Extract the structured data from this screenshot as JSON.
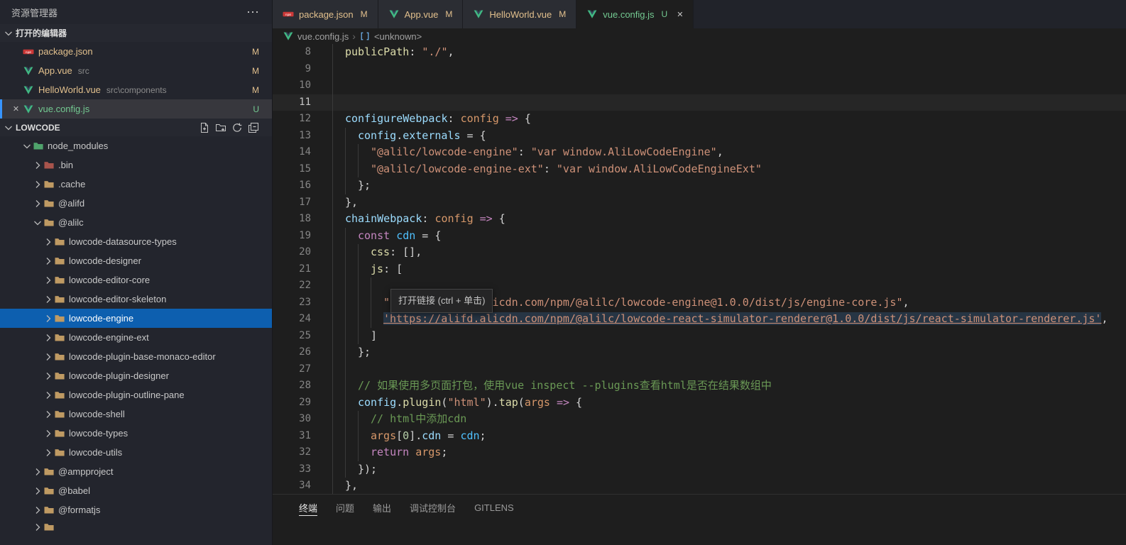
{
  "colors": {
    "accent_blue": "#0d5faf",
    "git_modified": "#e2c08d",
    "git_untracked": "#73c991",
    "folders": {
      "tan": "#bf9a63",
      "green": "#4fa36c",
      "red": "#a8544c"
    }
  },
  "explorer": {
    "title": "资源管理器",
    "open_editors": {
      "header": "打开的编辑器",
      "items": [
        {
          "icon": "npm-icon",
          "name": "package.json",
          "path": "",
          "badge": "M",
          "status": "modified",
          "active": false
        },
        {
          "icon": "vue-icon",
          "name": "App.vue",
          "path": "src",
          "badge": "M",
          "status": "modified",
          "active": false
        },
        {
          "icon": "vue-icon",
          "name": "HelloWorld.vue",
          "path": "src\\components",
          "badge": "M",
          "status": "modified",
          "active": false
        },
        {
          "icon": "vue-icon",
          "name": "vue.config.js",
          "path": "",
          "badge": "U",
          "status": "untracked",
          "active": true
        }
      ]
    },
    "project": {
      "header": "LOWCODE",
      "actions": [
        "new-file-icon",
        "new-folder-icon",
        "refresh-icon",
        "collapse-all-icon"
      ],
      "tree": [
        {
          "label": "node_modules",
          "depth": 0,
          "expanded": true,
          "folder": "green",
          "selected": false
        },
        {
          "label": ".bin",
          "depth": 1,
          "expanded": false,
          "folder": "red",
          "selected": false
        },
        {
          "label": ".cache",
          "depth": 1,
          "expanded": false,
          "folder": "tan",
          "selected": false
        },
        {
          "label": "@alifd",
          "depth": 1,
          "expanded": false,
          "folder": "tan",
          "selected": false
        },
        {
          "label": "@alilc",
          "depth": 1,
          "expanded": true,
          "folder": "tan",
          "selected": false
        },
        {
          "label": "lowcode-datasource-types",
          "depth": 2,
          "expanded": false,
          "folder": "tan",
          "selected": false
        },
        {
          "label": "lowcode-designer",
          "depth": 2,
          "expanded": false,
          "folder": "tan",
          "selected": false
        },
        {
          "label": "lowcode-editor-core",
          "depth": 2,
          "expanded": false,
          "folder": "tan",
          "selected": false
        },
        {
          "label": "lowcode-editor-skeleton",
          "depth": 2,
          "expanded": false,
          "folder": "tan",
          "selected": false
        },
        {
          "label": "lowcode-engine",
          "depth": 2,
          "expanded": false,
          "folder": "tan",
          "selected": true
        },
        {
          "label": "lowcode-engine-ext",
          "depth": 2,
          "expanded": false,
          "folder": "tan",
          "selected": false
        },
        {
          "label": "lowcode-plugin-base-monaco-editor",
          "depth": 2,
          "expanded": false,
          "folder": "tan",
          "selected": false
        },
        {
          "label": "lowcode-plugin-designer",
          "depth": 2,
          "expanded": false,
          "folder": "tan",
          "selected": false
        },
        {
          "label": "lowcode-plugin-outline-pane",
          "depth": 2,
          "expanded": false,
          "folder": "tan",
          "selected": false
        },
        {
          "label": "lowcode-shell",
          "depth": 2,
          "expanded": false,
          "folder": "tan",
          "selected": false
        },
        {
          "label": "lowcode-types",
          "depth": 2,
          "expanded": false,
          "folder": "tan",
          "selected": false
        },
        {
          "label": "lowcode-utils",
          "depth": 2,
          "expanded": false,
          "folder": "tan",
          "selected": false
        },
        {
          "label": "@ampproject",
          "depth": 1,
          "expanded": false,
          "folder": "tan",
          "selected": false
        },
        {
          "label": "@babel",
          "depth": 1,
          "expanded": false,
          "folder": "tan",
          "selected": false
        },
        {
          "label": "@formatjs",
          "depth": 1,
          "expanded": false,
          "folder": "tan",
          "selected": false
        },
        {
          "label": "",
          "depth": 1,
          "expanded": false,
          "folder": "tan",
          "selected": false,
          "partial": true
        }
      ]
    }
  },
  "tabs": [
    {
      "icon": "npm-icon",
      "label": "package.json",
      "badge": "M",
      "status": "modified",
      "active": false
    },
    {
      "icon": "vue-icon",
      "label": "App.vue",
      "badge": "M",
      "status": "modified",
      "active": false
    },
    {
      "icon": "vue-icon",
      "label": "HelloWorld.vue",
      "badge": "M",
      "status": "modified",
      "active": false
    },
    {
      "icon": "vue-icon",
      "label": "vue.config.js",
      "badge": "U",
      "status": "untracked",
      "active": true
    }
  ],
  "breadcrumb": {
    "items": [
      {
        "icon": "vue-icon",
        "label": "vue.config.js"
      },
      {
        "icon": "symbol-icon",
        "label": "<unknown>"
      }
    ]
  },
  "editor": {
    "lines": [
      {
        "n": 8,
        "ind": 2,
        "active": false,
        "tokens": [
          [
            "f",
            "publicPath"
          ],
          [
            "p",
            ": "
          ],
          [
            "s",
            "\"./\""
          ],
          [
            "p",
            ","
          ]
        ]
      },
      {
        "n": 9,
        "ind": 2,
        "active": false,
        "tokens": []
      },
      {
        "n": 10,
        "ind": 2,
        "active": false,
        "tokens": []
      },
      {
        "n": 11,
        "ind": 2,
        "active": true,
        "tokens": []
      },
      {
        "n": 12,
        "ind": 2,
        "active": false,
        "tokens": [
          [
            "v",
            "configureWebpack"
          ],
          [
            "p",
            ": "
          ],
          [
            "a",
            "config"
          ],
          [
            "p",
            " "
          ],
          [
            "k",
            "=>"
          ],
          [
            "p",
            " {"
          ]
        ]
      },
      {
        "n": 13,
        "ind": 4,
        "active": false,
        "tokens": [
          [
            "v",
            "config"
          ],
          [
            "p",
            "."
          ],
          [
            "v",
            "externals"
          ],
          [
            "p",
            " = {"
          ]
        ]
      },
      {
        "n": 14,
        "ind": 6,
        "active": false,
        "tokens": [
          [
            "s",
            "\"@alilc/lowcode-engine\""
          ],
          [
            "p",
            ": "
          ],
          [
            "s",
            "\"var window.AliLowCodeEngine\""
          ],
          [
            "p",
            ","
          ]
        ]
      },
      {
        "n": 15,
        "ind": 6,
        "active": false,
        "tokens": [
          [
            "s",
            "\"@alilc/lowcode-engine-ext\""
          ],
          [
            "p",
            ": "
          ],
          [
            "s",
            "\"var window.AliLowCodeEngineExt\""
          ]
        ]
      },
      {
        "n": 16,
        "ind": 4,
        "active": false,
        "tokens": [
          [
            "p",
            "};"
          ]
        ]
      },
      {
        "n": 17,
        "ind": 2,
        "active": false,
        "tokens": [
          [
            "p",
            "},"
          ]
        ]
      },
      {
        "n": 18,
        "ind": 2,
        "active": false,
        "tokens": [
          [
            "v",
            "chainWebpack"
          ],
          [
            "p",
            ": "
          ],
          [
            "a",
            "config"
          ],
          [
            "p",
            " "
          ],
          [
            "k",
            "=>"
          ],
          [
            "p",
            " {"
          ]
        ]
      },
      {
        "n": 19,
        "ind": 4,
        "active": false,
        "tokens": [
          [
            "k",
            "const"
          ],
          [
            "p",
            " "
          ],
          [
            "c",
            "cdn"
          ],
          [
            "p",
            " = {"
          ]
        ]
      },
      {
        "n": 20,
        "ind": 6,
        "active": false,
        "tokens": [
          [
            "f",
            "css"
          ],
          [
            "p",
            ": [],"
          ]
        ]
      },
      {
        "n": 21,
        "ind": 6,
        "active": false,
        "tokens": [
          [
            "f",
            "js"
          ],
          [
            "p",
            ": ["
          ]
        ]
      },
      {
        "n": 22,
        "ind": 8,
        "active": false,
        "tokens": []
      },
      {
        "n": 23,
        "ind": 8,
        "active": false,
        "tokens": [
          [
            "s",
            "\"https://alifd.alicdn.com/npm/@alilc/lowcode-engine@1.0.0/dist/js/engine-core.js\""
          ],
          [
            "p",
            ","
          ]
        ]
      },
      {
        "n": 24,
        "ind": 8,
        "active": false,
        "tokens": [
          [
            "sl",
            "'https://alifd.alicdn.com/npm/@alilc/lowcode-react-simulator-renderer@1.0.0/dist/js/react-simulator-renderer.js'"
          ],
          [
            "p",
            ","
          ]
        ]
      },
      {
        "n": 25,
        "ind": 6,
        "active": false,
        "tokens": [
          [
            "p",
            "]"
          ]
        ]
      },
      {
        "n": 26,
        "ind": 4,
        "active": false,
        "tokens": [
          [
            "p",
            "};"
          ]
        ]
      },
      {
        "n": 27,
        "ind": 4,
        "active": false,
        "tokens": []
      },
      {
        "n": 28,
        "ind": 4,
        "active": false,
        "tokens": [
          [
            "m",
            "// 如果使用多页面打包，使用vue inspect --plugins查看html是否在结果数组中"
          ]
        ]
      },
      {
        "n": 29,
        "ind": 4,
        "active": false,
        "tokens": [
          [
            "v",
            "config"
          ],
          [
            "p",
            "."
          ],
          [
            "f",
            "plugin"
          ],
          [
            "p",
            "("
          ],
          [
            "s",
            "\"html\""
          ],
          [
            "p",
            ")."
          ],
          [
            "f",
            "tap"
          ],
          [
            "p",
            "("
          ],
          [
            "a",
            "args"
          ],
          [
            "p",
            " "
          ],
          [
            "k",
            "=>"
          ],
          [
            "p",
            " {"
          ]
        ]
      },
      {
        "n": 30,
        "ind": 6,
        "active": false,
        "tokens": [
          [
            "m",
            "// html中添加cdn"
          ]
        ]
      },
      {
        "n": 31,
        "ind": 6,
        "active": false,
        "tokens": [
          [
            "a",
            "args"
          ],
          [
            "p",
            "["
          ],
          [
            "n",
            "0"
          ],
          [
            "p",
            "]."
          ],
          [
            "v",
            "cdn"
          ],
          [
            "p",
            " = "
          ],
          [
            "c",
            "cdn"
          ],
          [
            "p",
            ";"
          ]
        ]
      },
      {
        "n": 32,
        "ind": 6,
        "active": false,
        "tokens": [
          [
            "k",
            "return"
          ],
          [
            "p",
            " "
          ],
          [
            "a",
            "args"
          ],
          [
            "p",
            ";"
          ]
        ]
      },
      {
        "n": 33,
        "ind": 4,
        "active": false,
        "tokens": [
          [
            "p",
            "});"
          ]
        ]
      },
      {
        "n": 34,
        "ind": 2,
        "active": false,
        "tokens": [
          [
            "p",
            "},"
          ]
        ]
      }
    ]
  },
  "tooltip": {
    "text": "打开链接 (ctrl + 单击)"
  },
  "panel": {
    "tabs": [
      {
        "label": "终端",
        "active": true
      },
      {
        "label": "问题",
        "active": false
      },
      {
        "label": "输出",
        "active": false
      },
      {
        "label": "调试控制台",
        "active": false
      },
      {
        "label": "GITLENS",
        "active": false
      }
    ]
  }
}
